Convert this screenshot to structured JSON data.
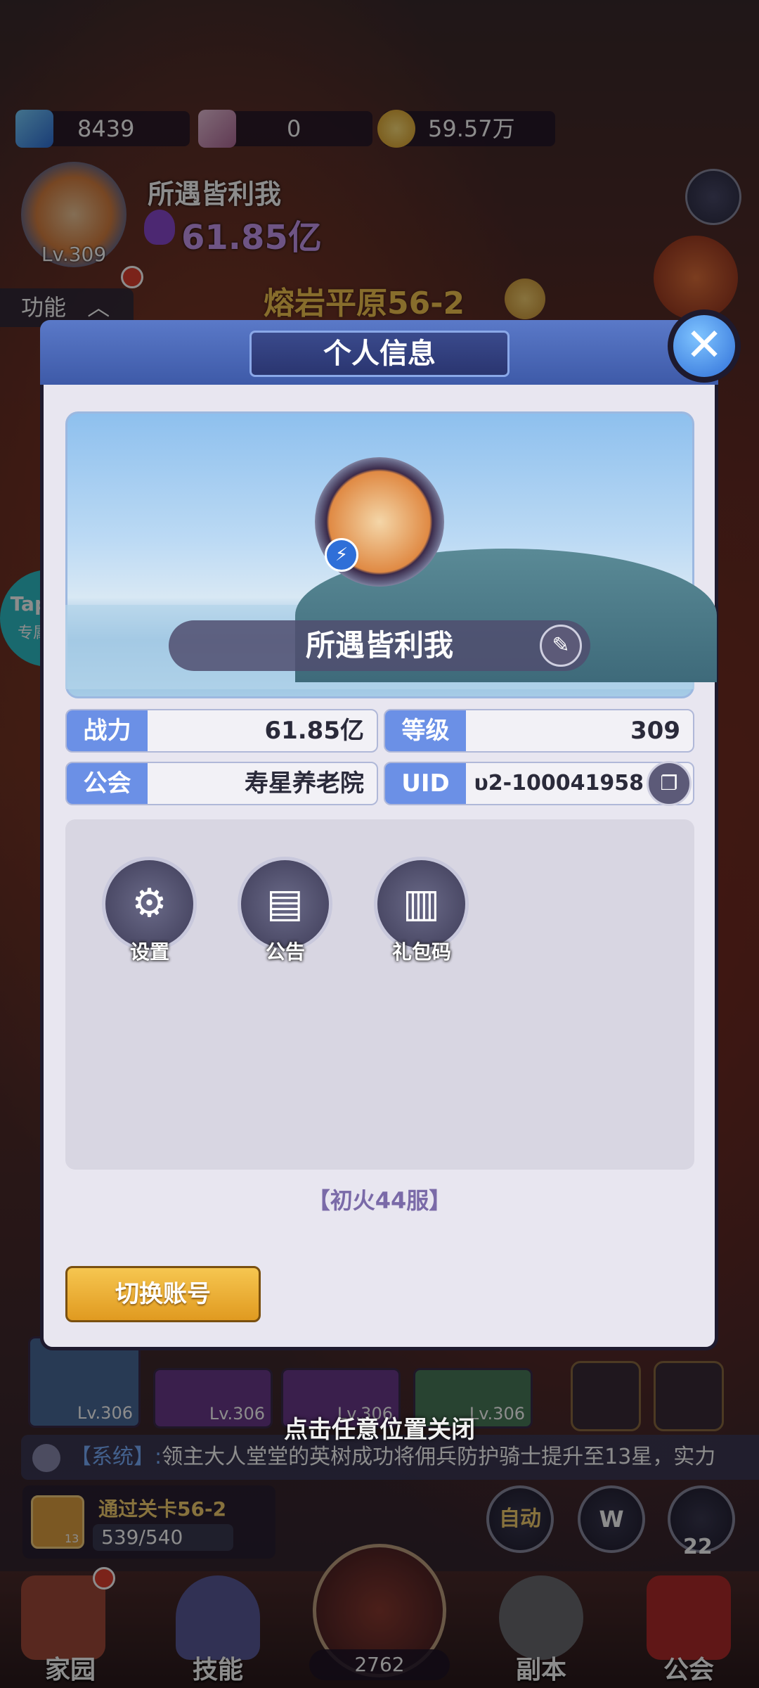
{
  "resources": {
    "diamonds": "8439",
    "flowers": "0",
    "gold": "59.57万"
  },
  "player": {
    "name": "所遇皆利我",
    "power": "61.85亿",
    "level": "Lv.309"
  },
  "hud": {
    "function_label": "功能",
    "stage_title": "熔岩平原56-2"
  },
  "taptap": {
    "brand": "TapTap",
    "label": "专属活动"
  },
  "dialog": {
    "title": "个人信息",
    "close_symbol": "✕",
    "name": "所遇皆利我",
    "stats": [
      {
        "label": "战力",
        "value": "61.85亿"
      },
      {
        "label": "等级",
        "value": "309"
      },
      {
        "label": "公会",
        "value": "寿星养老院"
      },
      {
        "label": "UID",
        "value": "υ2-100041958"
      }
    ],
    "functions": [
      {
        "label": "设置",
        "icon": "gear-icon"
      },
      {
        "label": "公告",
        "icon": "notice-board-icon"
      },
      {
        "label": "礼包码",
        "icon": "gift-code-icon"
      }
    ],
    "server": "【初火44服】",
    "switch_account": "切换账号"
  },
  "close_hint": "点击任意位置关闭",
  "heroes": [
    {
      "level": "Lv.306"
    },
    {
      "level": "Lv.306"
    },
    {
      "level": "Lv.306"
    },
    {
      "level": "Lv.306"
    }
  ],
  "system_message": {
    "prefix": "【系统】:",
    "text": "领主大人堂堂的英树成功将佣兵防护骑士提升至13星，实力"
  },
  "quest": {
    "title": "通过关卡56-2",
    "progress": "539/540",
    "badge": "13"
  },
  "side_buttons": {
    "auto": "自动",
    "w": "W",
    "count": "22"
  },
  "bottom_nav": {
    "home": "家园",
    "skills": "技能",
    "battle_count": "2762",
    "dungeon": "副本",
    "guild": "公会"
  },
  "colors": {
    "accent_blue": "#6b90e6",
    "gold_button": "#f6c650",
    "server_text": "#7a6aa8"
  }
}
